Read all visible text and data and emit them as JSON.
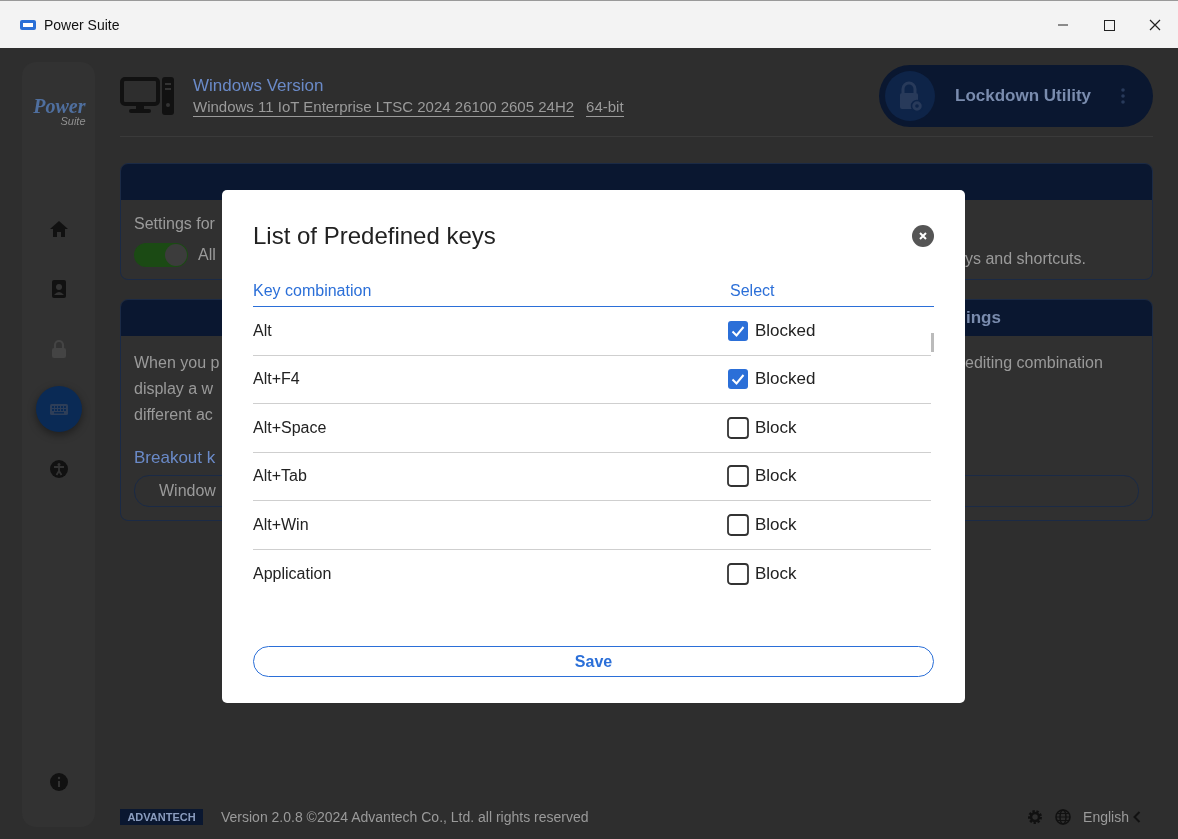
{
  "window": {
    "title": "Power Suite"
  },
  "sidebar": {
    "logo": {
      "word": "Power",
      "sub": "Suite"
    },
    "items": [
      {
        "selected": false,
        "disabled": false
      },
      {
        "selected": false,
        "disabled": false
      },
      {
        "selected": false,
        "disabled": true
      },
      {
        "selected": true,
        "disabled": false
      },
      {
        "selected": false,
        "disabled": false
      }
    ]
  },
  "header": {
    "label": "Windows Version",
    "version": "Windows 11 IoT Enterprise LTSC 2024 26100 2605 24H2",
    "arch": "64-bit",
    "utility": "Lockdown Utility"
  },
  "cards": [
    {
      "kind": "toggle",
      "lead": "Settings for",
      "toggle": {
        "on": true,
        "label": "All"
      },
      "trail": "ys and shortcuts."
    },
    {
      "kind": "breakout",
      "heading": "ings",
      "lines": [
        "When you p",
        "display a w",
        "different ac"
      ],
      "trail": "editing combination",
      "subheading": "Breakout k",
      "field": {
        "value": "Window"
      }
    }
  ],
  "dialog": {
    "title": "List of Predefined keys",
    "columns": [
      "Key combination",
      "Select"
    ],
    "rows": [
      {
        "key": "Alt",
        "checked": true,
        "label": "Blocked"
      },
      {
        "key": "Alt+F4",
        "checked": true,
        "label": "Blocked"
      },
      {
        "key": "Alt+Space",
        "checked": false,
        "label": "Block"
      },
      {
        "key": "Alt+Tab",
        "checked": false,
        "label": "Block"
      },
      {
        "key": "Alt+Win",
        "checked": false,
        "label": "Block"
      },
      {
        "key": "Application",
        "checked": false,
        "label": "Block"
      }
    ],
    "save": "Save"
  },
  "footer": {
    "brand": "ADVANTECH",
    "version": "Version 2.0.8 ©2024 Advantech Co., Ltd. all rights reserved",
    "language": "English"
  }
}
